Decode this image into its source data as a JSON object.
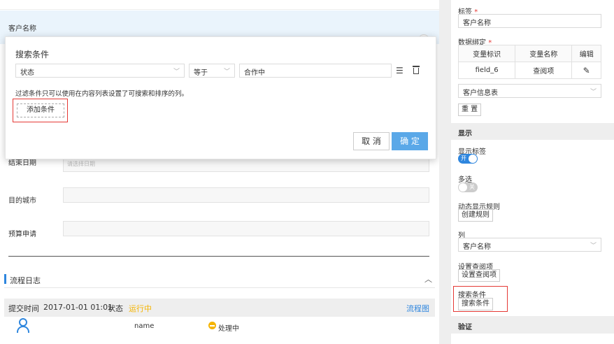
{
  "form": {
    "customer_row_label": "客户名称",
    "rows": [
      {
        "label": "结束日期",
        "placeholder": "请选择日期"
      },
      {
        "label": "目的城市"
      },
      {
        "label": "预算申请"
      }
    ]
  },
  "modal": {
    "title": "搜索条件",
    "field_select": "状态",
    "operator_select": "等于",
    "value_input": "合作中",
    "hint": "过滤条件只可以使用在内容列表设置了可搜索和排序的列。",
    "add_condition": "添加条件",
    "cancel": "取 消",
    "confirm": "确 定"
  },
  "log": {
    "title": "流程日志",
    "submit_time_label": "提交时间",
    "submit_time": "2017-01-01 01:01",
    "status_label": "状态",
    "status_value": "运行中",
    "flow_chart_link": "流程图",
    "name_cell": "name",
    "processing": "处理中"
  },
  "right_panel": {
    "tag_label": "标签",
    "tag_value": "客户名称",
    "binding_label": "数据绑定",
    "binding_table": {
      "headers": [
        "变量标识",
        "变量名称",
        "编辑"
      ],
      "row": {
        "id": "field_6",
        "name": "查阅项"
      }
    },
    "source_select": "客户信息表",
    "reset_button": "重 置",
    "display_section": "显示",
    "show_label_label": "显示标签",
    "show_label_toggle": "开",
    "multi_select_label": "多选",
    "multi_select_toggle": "关",
    "dynamic_rule_label": "动态显示规则",
    "create_rule_button": "创建规则",
    "column_label": "列",
    "column_select": "客户名称",
    "lookup_label": "设置查阅项",
    "lookup_button": "设置查阅项",
    "search_label": "搜索条件",
    "search_button": "搜索条件",
    "verify_section": "验证"
  },
  "colors": {
    "accent": "#2e86de",
    "highlight_red": "#e53935",
    "running": "#f5b400",
    "confirm": "#5aa8e8"
  },
  "icons": [
    "list-icon",
    "trash-icon",
    "pencil-icon",
    "user-icon",
    "chevron-down-icon",
    "chevron-up-icon"
  ]
}
